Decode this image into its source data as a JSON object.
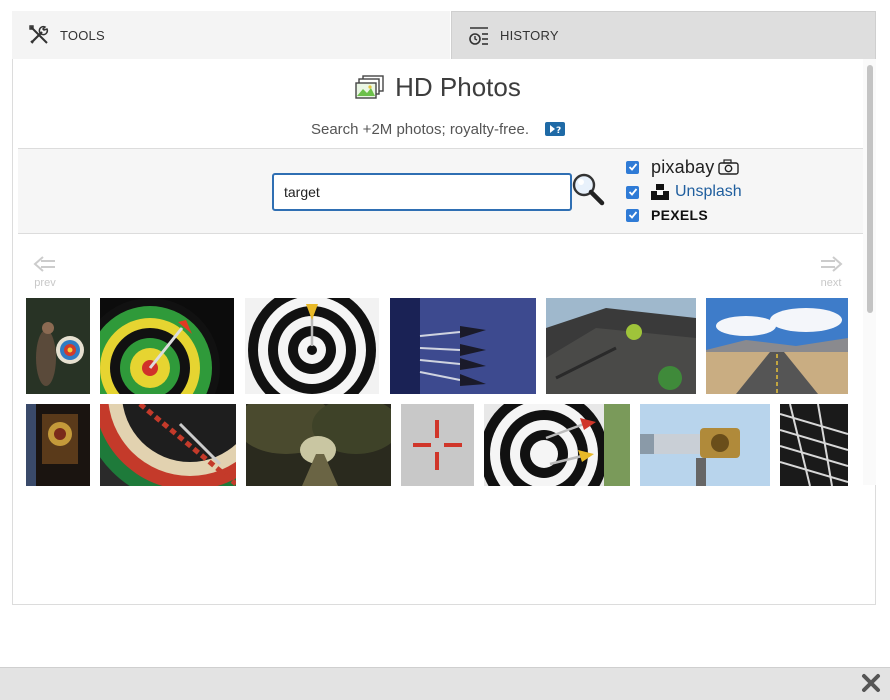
{
  "tabs": [
    {
      "label": "TOOLS",
      "icon": "tools-icon"
    },
    {
      "label": "HISTORY",
      "icon": "history-icon"
    }
  ],
  "header": {
    "title": "HD Photos",
    "subtitle": "Search +2M photos; royalty-free."
  },
  "search": {
    "value": "target",
    "placeholder": ""
  },
  "sources": [
    {
      "label": "pixabay",
      "checked": true
    },
    {
      "label": "Unsplash",
      "checked": true
    },
    {
      "label": "PEXELS",
      "checked": true
    }
  ],
  "pagination": {
    "prev_label": "prev",
    "next_label": "next"
  },
  "photos_row1": [
    {
      "subject": "archer aiming at target"
    },
    {
      "subject": "green yellow dartboard with red dart"
    },
    {
      "subject": "black white target with yellow dart"
    },
    {
      "subject": "darts stuck in blue target"
    },
    {
      "subject": "rock with green plant"
    },
    {
      "subject": "desert road under cloudy sky"
    }
  ],
  "photos_row2": [
    {
      "subject": "dartboard in dark room"
    },
    {
      "subject": "close-up dartboard with dart"
    },
    {
      "subject": "forest path with trees"
    },
    {
      "subject": "red crosshair on wall"
    },
    {
      "subject": "target with red and yellow darts"
    },
    {
      "subject": "brass telescope"
    },
    {
      "subject": "black white abstract"
    }
  ],
  "colors": {
    "accent": "#2f6fb3",
    "link": "#1f5e9e"
  }
}
